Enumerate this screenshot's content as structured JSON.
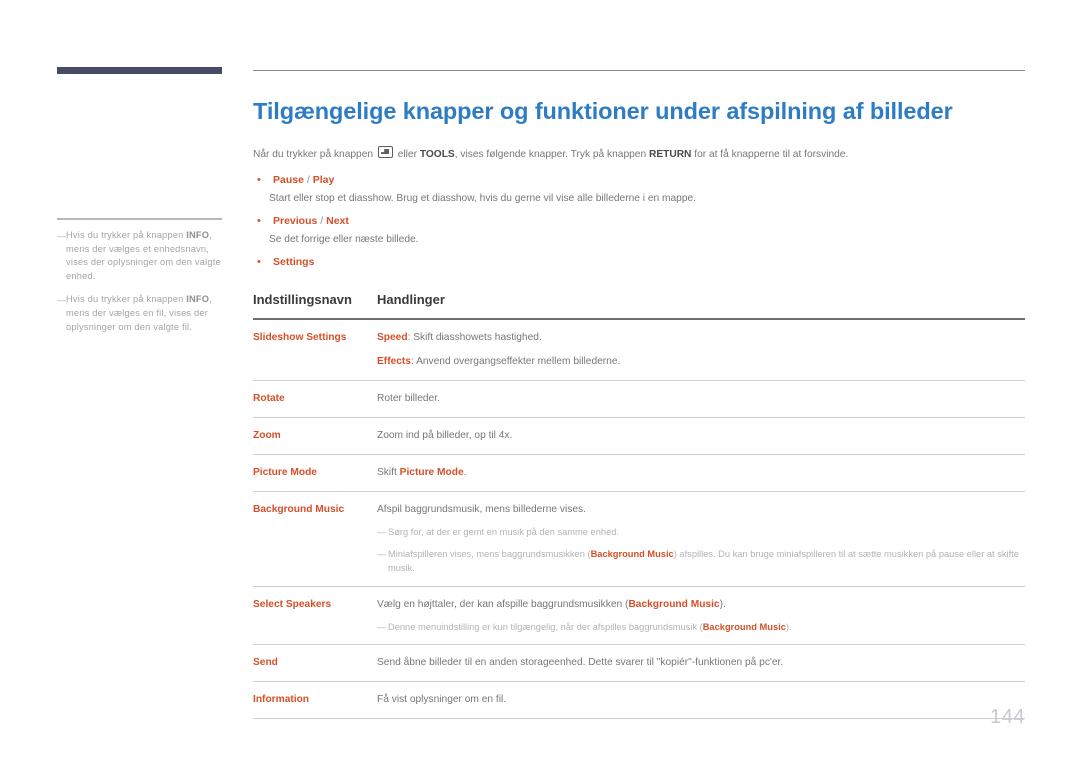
{
  "header": {
    "bar_color": "#494a63",
    "rule_color": "#8a8a8a"
  },
  "page": {
    "title": "Tilgængelige knapper og funktioner under afspilning af billeder",
    "title_color": "#2e7dc4",
    "accent_color": "#d4502a",
    "number": "144"
  },
  "intro": {
    "part1": "Når du trykker på knappen ",
    "icon": "enter-key-icon",
    "part2": " eller ",
    "tools": "TOOLS",
    "part3": ", vises følgende knapper. Tryk på knappen ",
    "return": "RETURN",
    "part4": " for at få knapperne til at forsvinde."
  },
  "sidebar": {
    "notes": [
      {
        "dash": "―",
        "part1": "Hvis du trykker på knappen ",
        "bold": "INFO",
        "part2": ", mens der vælges et enhedsnavn, vises der oplysninger om den valgte enhed."
      },
      {
        "dash": "―",
        "part1": "Hvis du trykker på knappen ",
        "bold": "INFO",
        "part2": ", mens der vælges en fil, vises der oplysninger om den valgte fil."
      }
    ]
  },
  "bullets": [
    {
      "dot": "•",
      "title_a": "Pause",
      "sep": " / ",
      "title_b": "Play",
      "desc": "Start eller stop et diasshow. Brug et diasshow, hvis du gerne vil vise alle billederne i en mappe."
    },
    {
      "dot": "•",
      "title_a": "Previous",
      "sep": " / ",
      "title_b": "Next",
      "desc": "Se det forrige eller næste billede."
    },
    {
      "dot": "•",
      "title_a": "Settings",
      "sep": "",
      "title_b": "",
      "desc": ""
    }
  ],
  "table": {
    "headers": [
      "Indstillingsnavn",
      "Handlinger"
    ],
    "rows": [
      {
        "name": "Slideshow Settings",
        "lines": [
          {
            "hl": "Speed",
            "text": ": Skift diasshowets hastighed."
          },
          {
            "hl": "Effects",
            "text": ": Anvend overgangseffekter mellem billederne."
          }
        ],
        "notes": []
      },
      {
        "name": "Rotate",
        "lines": [
          {
            "hl": "",
            "text": "Roter billeder."
          }
        ],
        "notes": []
      },
      {
        "name": "Zoom",
        "lines": [
          {
            "hl": "",
            "text": "Zoom ind på billeder, op til 4x."
          }
        ],
        "notes": []
      },
      {
        "name": "Picture Mode",
        "lines": [
          {
            "hl": "",
            "text": "Skift ",
            "hl_after": "Picture Mode",
            "text_after": "."
          }
        ],
        "notes": []
      },
      {
        "name": "Background Music",
        "lines": [
          {
            "hl": "",
            "text": "Afspil baggrundsmusik, mens billederne vises."
          }
        ],
        "notes": [
          {
            "dash": "―",
            "part1": "Sørg for, at der er gemt en musik på den samme enhed.",
            "hl": "",
            "part2": ""
          },
          {
            "dash": "―",
            "part1": "Miniafspilleren vises, mens baggrundsmusikken (",
            "hl": "Background Music",
            "part2": ") afspilles. Du kan bruge miniafspilleren til at sætte musikken på pause eller at skifte musik."
          }
        ]
      },
      {
        "name": "Select Speakers",
        "lines": [
          {
            "hl": "",
            "text": "Vælg en højttaler, der kan afspille baggrundsmusikken (",
            "hl_after": "Background Music",
            "text_after": ")."
          }
        ],
        "notes": [
          {
            "dash": "―",
            "part1": "Denne menuindstilling er kun tilgængelig, når der afspilles baggrundsmusik (",
            "hl": "Background Music",
            "part2": ")."
          }
        ]
      },
      {
        "name": "Send",
        "lines": [
          {
            "hl": "",
            "text": "Send åbne billeder til en anden storageenhed. Dette svarer til \"kopiér\"-funktionen på pc'er."
          }
        ],
        "notes": []
      },
      {
        "name": "Information",
        "lines": [
          {
            "hl": "",
            "text": "Få vist oplysninger om en fil."
          }
        ],
        "notes": []
      }
    ]
  }
}
